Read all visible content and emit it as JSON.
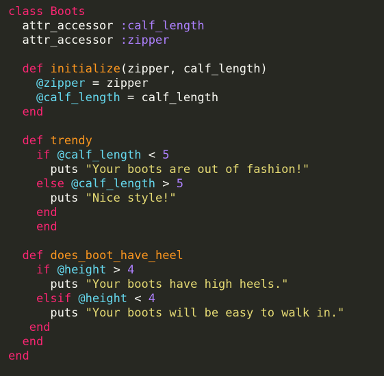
{
  "theme": {
    "background": "#272822",
    "keyword": "#f92672",
    "method_name": "#fd971f",
    "plain": "#f8f8f2",
    "symbol": "#ae81ff",
    "instance_variable": "#66d9ef",
    "number": "#ae81ff",
    "string": "#e6db74"
  },
  "lines": [
    [
      [
        "class",
        "keyword"
      ],
      [
        " ",
        "plain"
      ],
      [
        "Boots",
        "keyword"
      ]
    ],
    [
      [
        "  attr_accessor ",
        "plain"
      ],
      [
        ":calf_length",
        "symbol"
      ]
    ],
    [
      [
        "  attr_accessor ",
        "plain"
      ],
      [
        ":zipper",
        "symbol"
      ]
    ],
    [],
    [
      [
        "  ",
        "plain"
      ],
      [
        "def",
        "keyword"
      ],
      [
        " ",
        "plain"
      ],
      [
        "initialize",
        "def-name"
      ],
      [
        "(zipper, calf_length)",
        "plain"
      ]
    ],
    [
      [
        "    ",
        "plain"
      ],
      [
        "@zipper",
        "ivar"
      ],
      [
        " = zipper",
        "plain"
      ]
    ],
    [
      [
        "    ",
        "plain"
      ],
      [
        "@calf_length",
        "ivar"
      ],
      [
        " = calf_length",
        "plain"
      ]
    ],
    [
      [
        "  ",
        "plain"
      ],
      [
        "end",
        "keyword"
      ]
    ],
    [],
    [
      [
        "  ",
        "plain"
      ],
      [
        "def",
        "keyword"
      ],
      [
        " ",
        "plain"
      ],
      [
        "trendy",
        "def-name"
      ]
    ],
    [
      [
        "    ",
        "plain"
      ],
      [
        "if",
        "keyword"
      ],
      [
        " ",
        "plain"
      ],
      [
        "@calf_length",
        "ivar"
      ],
      [
        " < ",
        "plain"
      ],
      [
        "5",
        "number"
      ]
    ],
    [
      [
        "      puts ",
        "plain"
      ],
      [
        "\"Your boots are out of fashion!\"",
        "string"
      ]
    ],
    [
      [
        "    ",
        "plain"
      ],
      [
        "else",
        "keyword"
      ],
      [
        " ",
        "plain"
      ],
      [
        "@calf_length",
        "ivar"
      ],
      [
        " > ",
        "plain"
      ],
      [
        "5",
        "number"
      ]
    ],
    [
      [
        "      puts ",
        "plain"
      ],
      [
        "\"Nice style!\"",
        "string"
      ]
    ],
    [
      [
        "    ",
        "plain"
      ],
      [
        "end",
        "keyword"
      ]
    ],
    [
      [
        "    ",
        "plain"
      ],
      [
        "end",
        "keyword"
      ]
    ],
    [],
    [
      [
        "  ",
        "plain"
      ],
      [
        "def",
        "keyword"
      ],
      [
        " ",
        "plain"
      ],
      [
        "does_boot_have_heel",
        "def-name"
      ]
    ],
    [
      [
        "    ",
        "plain"
      ],
      [
        "if",
        "keyword"
      ],
      [
        " ",
        "plain"
      ],
      [
        "@height",
        "ivar"
      ],
      [
        " > ",
        "plain"
      ],
      [
        "4",
        "number"
      ]
    ],
    [
      [
        "      puts ",
        "plain"
      ],
      [
        "\"Your boots have high heels.\"",
        "string"
      ]
    ],
    [
      [
        "    ",
        "plain"
      ],
      [
        "elsif",
        "keyword"
      ],
      [
        " ",
        "plain"
      ],
      [
        "@height",
        "ivar"
      ],
      [
        " < ",
        "plain"
      ],
      [
        "4",
        "number"
      ]
    ],
    [
      [
        "      puts ",
        "plain"
      ],
      [
        "\"Your boots will be easy to walk in.\"",
        "string"
      ]
    ],
    [
      [
        "   ",
        "plain"
      ],
      [
        "end",
        "keyword"
      ]
    ],
    [
      [
        "  ",
        "plain"
      ],
      [
        "end",
        "keyword"
      ]
    ],
    [
      [
        "end",
        "keyword"
      ]
    ]
  ]
}
